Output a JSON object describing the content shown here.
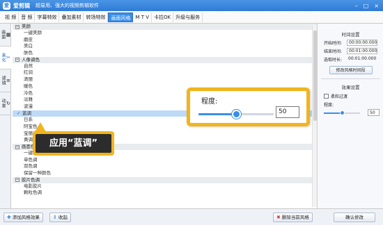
{
  "app": {
    "name": "爱剪辑",
    "slogan": "超易用、强大的视频剪辑软件",
    "logo_text": "爱",
    "window_buttons": [
      "–",
      "□",
      "×"
    ]
  },
  "menu": [
    "视 频",
    "音 频",
    "字幕特效",
    "叠加素材",
    "转场特效",
    "画面风格",
    "M T V",
    "卡拉OK",
    "升级与服务"
  ],
  "menu_active_index": 5,
  "left_tabs": [
    {
      "icon": "▦",
      "label": "画面"
    },
    {
      "icon": "✂",
      "label": "美化"
    },
    {
      "icon": "≡",
      "label": "滤镜"
    },
    {
      "icon": "↻",
      "label": "动景"
    }
  ],
  "style_list": {
    "categories": [
      {
        "name": "美颜",
        "items": [
          "一键美颜",
          "磨皮",
          "美白",
          "肤色"
        ]
      },
      {
        "name": "人像调色",
        "items": [
          "自然",
          "红润",
          "清丽",
          "暖色",
          "冷色",
          "淡雅",
          "波漫",
          "蓝调",
          "日系",
          "阿宝色",
          "宝丽来",
          "黄调"
        ]
      },
      {
        "name": "画面色调",
        "items": [
          "一键电影专业调色",
          "单色调",
          "双色调",
          "保留一种颜色"
        ]
      },
      {
        "name": "胶片色调",
        "items": [
          "电影胶片",
          "颗粒色调"
        ]
      }
    ],
    "selected": "蓝调"
  },
  "right_panel": {
    "time_title": "时间设置",
    "start_label": "开始时间:",
    "start_value": "00:00:00.000",
    "end_label": "结束时间:",
    "end_value": "00:01:00.000",
    "duration_label": "选取时长:",
    "duration_value": "00:01:00.000",
    "modify_time_button": "修改风格时间段",
    "effect_title": "效果设置",
    "soft_transition_label": "柔和过渡",
    "degree_label": "程度:",
    "degree_value": "50",
    "confirm_button": "确认修改"
  },
  "bottom": {
    "add_style_button": "添加风格效果",
    "collapse_button": "收起",
    "delete_style_button": "删除当前风格"
  },
  "callouts": {
    "degree_label": "程度:",
    "degree_value": "50",
    "apply_text": "应用“蓝调”"
  },
  "slider": {
    "fraction": 0.5
  },
  "colors": {
    "accent": "#3a8ee6",
    "callout": "#f1b41d",
    "selected_row": "#bfdaf7"
  }
}
